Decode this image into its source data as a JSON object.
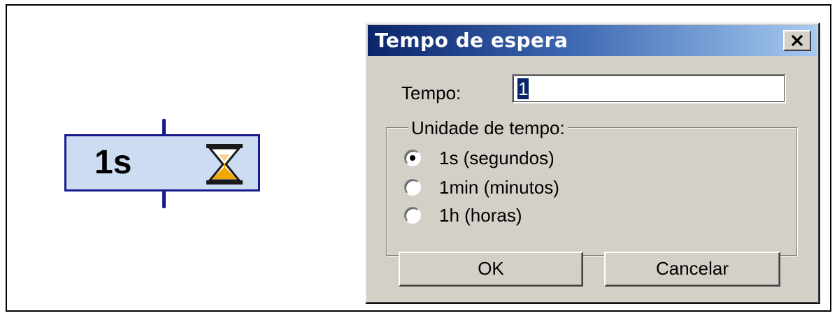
{
  "timer_block": {
    "label": "1s"
  },
  "dialog": {
    "title": "Tempo de espera",
    "tempo_label": "Tempo:",
    "tempo_value": "1",
    "group_title": "Unidade de tempo:",
    "options": [
      {
        "label": "1s (segundos)",
        "selected": true
      },
      {
        "label": "1min (minutos)",
        "selected": false
      },
      {
        "label": "1h (horas)",
        "selected": false
      }
    ],
    "ok_label": "OK",
    "cancel_label": "Cancelar"
  },
  "icons": [
    "hourglass-icon",
    "close-icon",
    "radio-selected-icon",
    "radio-unselected-icon"
  ],
  "colors": {
    "block_fill": "#ccdcf2",
    "block_border": "#1a1a8c",
    "title_gradient_start": "#0a246a",
    "title_gradient_end": "#a6caf0",
    "dialog_bg": "#d4d0c8",
    "sand": "#f0a800"
  }
}
